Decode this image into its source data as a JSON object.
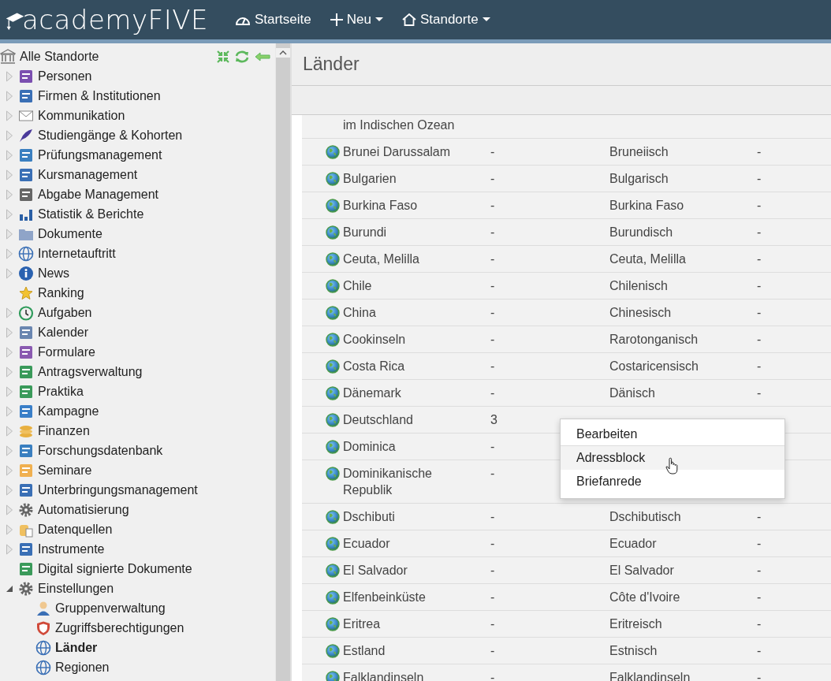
{
  "header": {
    "logo": "academyFIVE",
    "nav": [
      {
        "label": "Startseite",
        "has_menu": false
      },
      {
        "label": "Neu",
        "has_menu": true
      },
      {
        "label": "Standorte",
        "has_menu": true
      }
    ]
  },
  "sidebar": {
    "root": "Alle Standorte",
    "items": [
      {
        "label": "Personen",
        "expanded": false,
        "selected": false
      },
      {
        "label": "Firmen & Institutionen",
        "expanded": false,
        "selected": false
      },
      {
        "label": "Kommunikation",
        "expanded": false,
        "selected": false
      },
      {
        "label": "Studiengänge & Kohorten",
        "expanded": false,
        "selected": false
      },
      {
        "label": "Prüfungsmanagement",
        "expanded": false,
        "selected": false
      },
      {
        "label": "Kursmanagement",
        "expanded": false,
        "selected": false
      },
      {
        "label": "Abgabe Management",
        "expanded": false,
        "selected": false
      },
      {
        "label": "Statistik & Berichte",
        "expanded": false,
        "selected": false
      },
      {
        "label": "Dokumente",
        "expanded": false,
        "selected": false
      },
      {
        "label": "Internetauftritt",
        "expanded": false,
        "selected": false
      },
      {
        "label": "News",
        "expanded": false,
        "selected": false
      },
      {
        "label": "Ranking",
        "selected": false
      },
      {
        "label": "Aufgaben",
        "expanded": false,
        "selected": false
      },
      {
        "label": "Kalender",
        "expanded": false,
        "selected": false
      },
      {
        "label": "Formulare",
        "expanded": false,
        "selected": false
      },
      {
        "label": "Antragsverwaltung",
        "expanded": false,
        "selected": false
      },
      {
        "label": "Praktika",
        "expanded": false,
        "selected": false
      },
      {
        "label": "Kampagne",
        "expanded": false,
        "selected": false
      },
      {
        "label": "Finanzen",
        "expanded": false,
        "selected": false
      },
      {
        "label": "Forschungsdatenbank",
        "expanded": false,
        "selected": false
      },
      {
        "label": "Seminare",
        "expanded": false,
        "selected": false
      },
      {
        "label": "Unterbringungsmanagement",
        "expanded": false,
        "selected": false
      },
      {
        "label": "Automatisierung",
        "expanded": false,
        "selected": false
      },
      {
        "label": "Datenquellen",
        "expanded": false,
        "selected": false
      },
      {
        "label": "Instrumente",
        "expanded": false,
        "selected": false
      },
      {
        "label": "Digital signierte Dokumente",
        "selected": false
      },
      {
        "label": "Einstellungen",
        "expanded": true,
        "selected": false,
        "children": [
          {
            "label": "Gruppenverwaltung",
            "selected": false
          },
          {
            "label": "Zugriffsberechtigungen",
            "selected": false
          },
          {
            "label": "Länder",
            "selected": true
          },
          {
            "label": "Regionen",
            "selected": false
          }
        ]
      }
    ]
  },
  "main": {
    "title": "Länder",
    "rows": [
      {
        "kind": "continuation",
        "name": "im Indischen Ozean"
      },
      {
        "kind": "country",
        "name": "Brunei Darussalam",
        "column_2": "-",
        "column_3": "Bruneiisch",
        "column_4": "-"
      },
      {
        "kind": "country",
        "name": "Bulgarien",
        "column_2": "-",
        "column_3": "Bulgarisch",
        "column_4": "-"
      },
      {
        "kind": "country",
        "name": "Burkina Faso",
        "column_2": "-",
        "column_3": "Burkina Faso",
        "column_4": "-"
      },
      {
        "kind": "country",
        "name": "Burundi",
        "column_2": "-",
        "column_3": "Burundisch",
        "column_4": "-"
      },
      {
        "kind": "country",
        "name": "Ceuta, Melilla",
        "column_2": "-",
        "column_3": "Ceuta, Melilla",
        "column_4": "-"
      },
      {
        "kind": "country",
        "name": "Chile",
        "column_2": "-",
        "column_3": "Chilenisch",
        "column_4": "-"
      },
      {
        "kind": "country",
        "name": "China",
        "column_2": "-",
        "column_3": "Chinesisch",
        "column_4": "-"
      },
      {
        "kind": "country",
        "name": "Cookinseln",
        "column_2": "-",
        "column_3": "Rarotonganisch",
        "column_4": "-"
      },
      {
        "kind": "country",
        "name": "Costa Rica",
        "column_2": "-",
        "column_3": "Costaricensisch",
        "column_4": "-"
      },
      {
        "kind": "country",
        "name": "Dänemark",
        "column_2": "-",
        "column_3": "Dänisch",
        "column_4": "-"
      },
      {
        "kind": "country",
        "name": "Deutschland",
        "column_2": "3"
      },
      {
        "kind": "country",
        "name": "Dominica",
        "column_2": "-"
      },
      {
        "kind": "country",
        "name": "Dominikanische Republik",
        "column_2": "-"
      },
      {
        "kind": "country",
        "name": "Dschibuti",
        "column_2": "-",
        "column_3": "Dschibutisch",
        "column_4": "-"
      },
      {
        "kind": "country",
        "name": "Ecuador",
        "column_2": "-",
        "column_3": "Ecuador",
        "column_4": "-"
      },
      {
        "kind": "country",
        "name": "El Salvador",
        "column_2": "-",
        "column_3": "El Salvador",
        "column_4": "-"
      },
      {
        "kind": "country",
        "name": "Elfenbeinküste",
        "column_2": "-",
        "column_3": "Côte d'Ivoire",
        "column_4": "-"
      },
      {
        "kind": "country",
        "name": "Eritrea",
        "column_2": "-",
        "column_3": "Eritreisch",
        "column_4": "-"
      },
      {
        "kind": "country",
        "name": "Estland",
        "column_2": "-",
        "column_3": "Estnisch",
        "column_4": "-"
      },
      {
        "kind": "country",
        "name": "Falklandinseln",
        "column_2": "-",
        "column_3": "Falklandinseln",
        "column_4": "-"
      }
    ],
    "context_menu": {
      "items": [
        {
          "label": "Bearbeiten",
          "hovered": false
        },
        {
          "label": "Adressblock",
          "hovered": true
        },
        {
          "label": "Briefanrede",
          "hovered": false
        }
      ]
    }
  }
}
